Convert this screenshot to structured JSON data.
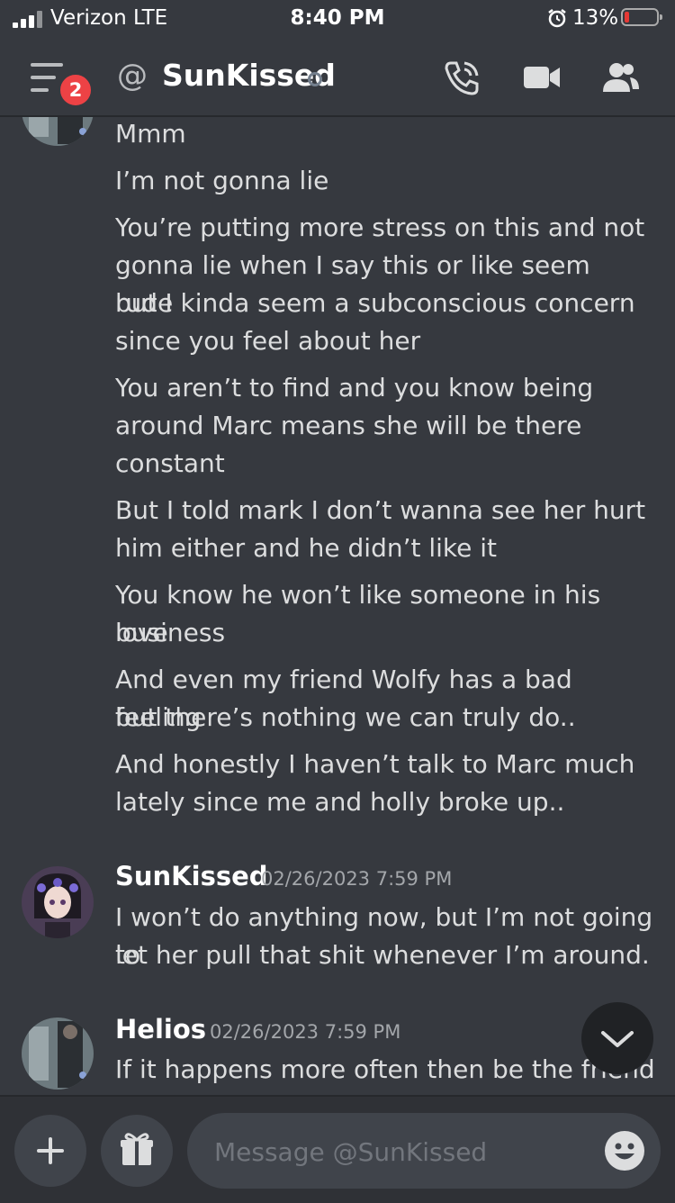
{
  "status_bar": {
    "carrier": "Verizon  LTE",
    "time": "8:40 PM",
    "battery": "13%"
  },
  "header": {
    "badge_count": "2",
    "title": "SunKissed"
  },
  "messages": {
    "group1": {
      "lines": [
        "Mmm",
        "I’m not gonna lie",
        "You’re putting more stress on this and not",
        "gonna lie when I say this or like seem rude",
        "but I kinda seem a subconscious concern",
        "since you feel about her",
        "You aren’t to find and you know being",
        "around Marc means she will be there",
        "constant",
        "But I told mark I don’t wanna see her hurt",
        "him either and he didn’t like it",
        "You know he won’t like someone in his love",
        "business",
        "And even my friend Wolfy has a bad feeling",
        "but there’s nothing we can truly do..",
        "And honestly I haven’t talk to Marc much",
        "lately since me and holly broke up.."
      ]
    },
    "group2": {
      "author": "SunKissed",
      "timestamp": "02/26/2023 7:59 PM",
      "lines": [
        "I won’t do anything now, but I’m not going to",
        "let her pull that shit whenever I’m around."
      ]
    },
    "group3": {
      "author": "Helios",
      "timestamp": "02/26/2023 7:59 PM",
      "lines": [
        "If it happens more often then be the friend"
      ]
    }
  },
  "composer": {
    "placeholder": "Message @SunKissed"
  },
  "colors": {
    "background": "#36393f",
    "composer": "#2f3136",
    "badge": "#ed4245",
    "text": "#dcddde"
  }
}
